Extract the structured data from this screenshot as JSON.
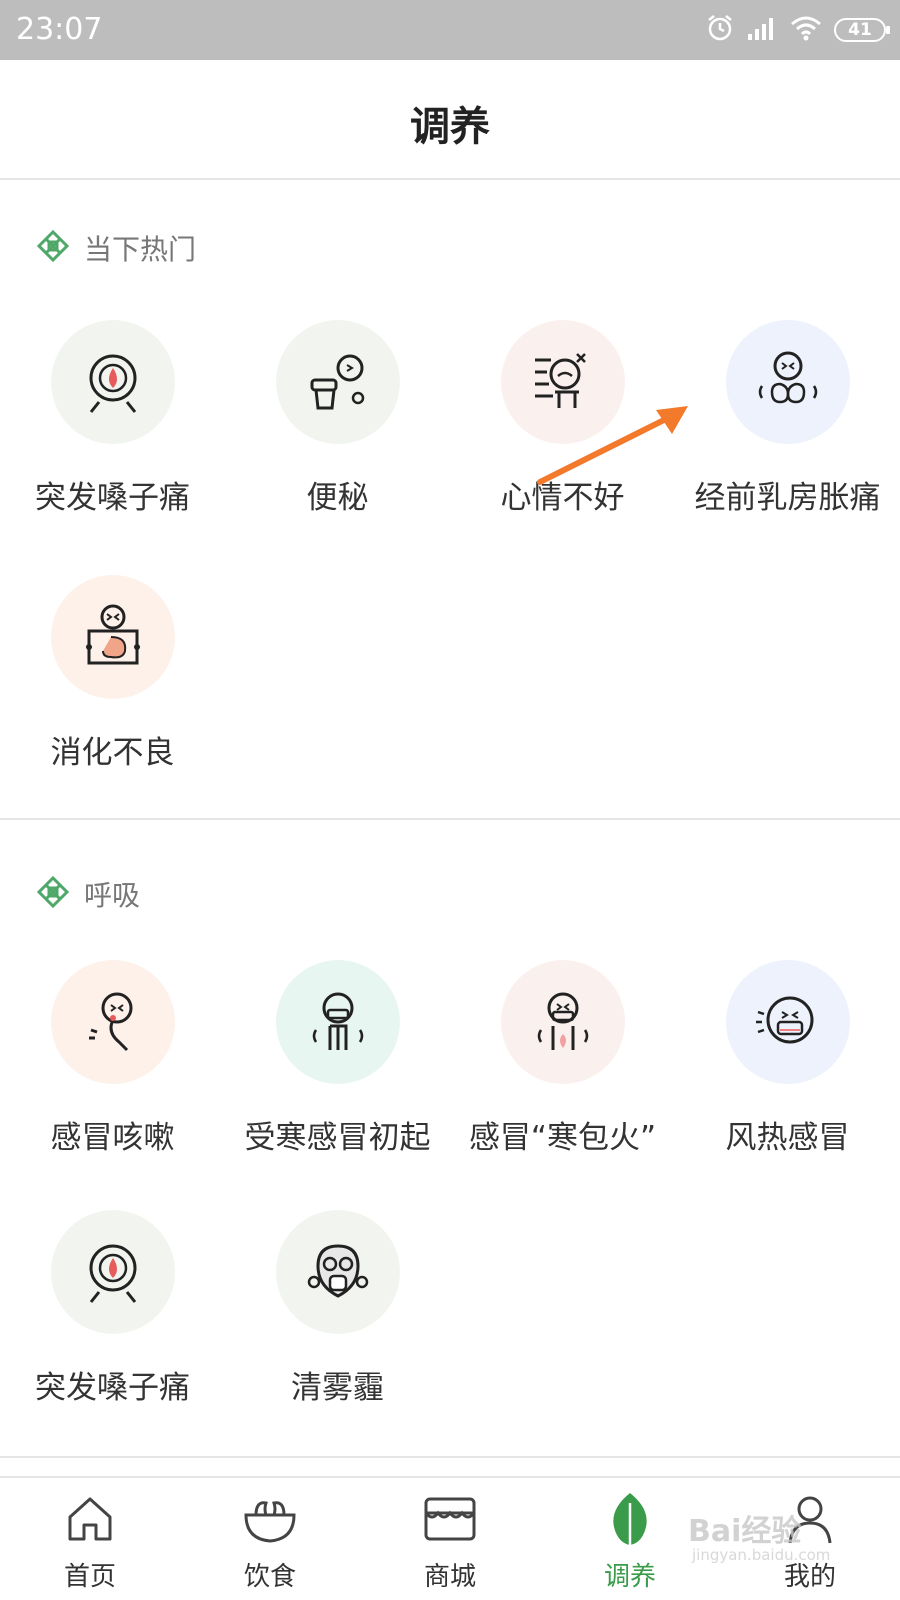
{
  "status_bar": {
    "time": "23:07",
    "battery": "41"
  },
  "header": {
    "title": "调养"
  },
  "sections": [
    {
      "title": "当下热门",
      "items": [
        {
          "label": "突发嗓子痛",
          "icon": "sore-throat-icon",
          "bg": "#f2f5ef"
        },
        {
          "label": "便秘",
          "icon": "constipation-icon",
          "bg": "#f2f5ef"
        },
        {
          "label": "心情不好",
          "icon": "bad-mood-icon",
          "bg": "#faf1ef"
        },
        {
          "label": "经前乳房胀痛",
          "icon": "breast-pain-icon",
          "bg": "#eef2fc"
        },
        {
          "label": "消化不良",
          "icon": "indigestion-icon",
          "bg": "#fdf1ea"
        }
      ]
    },
    {
      "title": "呼吸",
      "items": [
        {
          "label": "感冒咳嗽",
          "icon": "cough-icon",
          "bg": "#fdf1ea"
        },
        {
          "label": "受寒感冒初起",
          "icon": "chill-cold-icon",
          "bg": "#e8f6f2"
        },
        {
          "label": "感冒“寒包火”",
          "icon": "cold-fire-icon",
          "bg": "#faf1ef"
        },
        {
          "label": "风热感冒",
          "icon": "wind-heat-icon",
          "bg": "#eef2fc"
        },
        {
          "label": "突发嗓子痛",
          "icon": "sore-throat-icon",
          "bg": "#f2f5ef"
        },
        {
          "label": "清雾霾",
          "icon": "gas-mask-icon",
          "bg": "#f2f5ef"
        }
      ]
    }
  ],
  "tabs": [
    {
      "label": "首页",
      "icon": "home-icon",
      "active": false
    },
    {
      "label": "饮食",
      "icon": "bowl-icon",
      "active": false
    },
    {
      "label": "商城",
      "icon": "shop-icon",
      "active": false
    },
    {
      "label": "调养",
      "icon": "leaf-icon",
      "active": true
    },
    {
      "label": "我的",
      "icon": "profile-icon",
      "active": false
    }
  ],
  "watermark": {
    "text": "Bai经验",
    "sub": "jingyan.baidu.com"
  },
  "colors": {
    "accent": "#3a9b4a",
    "annotation_arrow": "#f27a2a",
    "status_bar": "#bdbdbd"
  }
}
